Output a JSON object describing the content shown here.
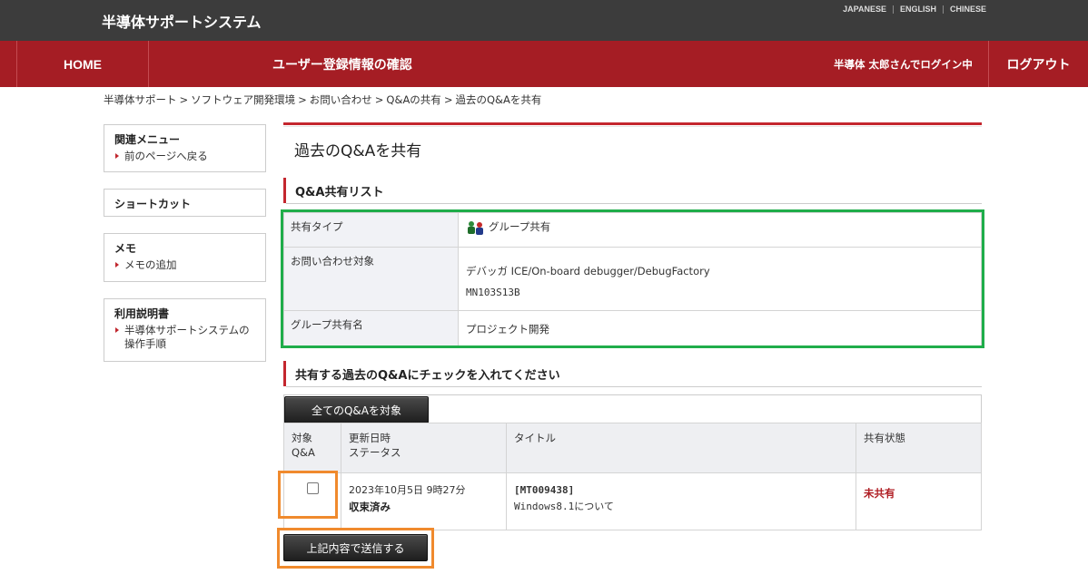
{
  "header": {
    "brand": "半導体サポートシステム",
    "languages": [
      "JAPANESE",
      "ENGLISH",
      "CHINESE"
    ]
  },
  "nav": {
    "home": "HOME",
    "title": "ユーザー登録情報の確認",
    "user_status": "半導体 太郎さんでログイン中",
    "logout": "ログアウト"
  },
  "breadcrumb": [
    "半導体サポート",
    "ソフトウェア開発環境",
    "お問い合わせ",
    "Q&Aの共有",
    "過去のQ&Aを共有"
  ],
  "breadcrumb_separator": ">",
  "sidebar": {
    "related_menu": {
      "title": "関連メニュー",
      "link": "前のページへ戻る"
    },
    "shortcut": {
      "title": "ショートカット"
    },
    "memo": {
      "title": "メモ",
      "link": "メモの追加"
    },
    "manual": {
      "title": "利用説明書",
      "link_line1": "半導体サポートシステムの",
      "link_line2": "操作手順"
    }
  },
  "page": {
    "title": "過去のQ&Aを共有",
    "section1_title": "Q&A共有リスト",
    "section2_title": "共有する過去のQ&Aにチェックを入れてください"
  },
  "info": {
    "share_type_label": "共有タイプ",
    "share_type_value": "グループ共有",
    "share_type_icon": "group-icon",
    "inquiry_label": "お問い合わせ対象",
    "inquiry_line1": "デバッガ ICE/On-board debugger/DebugFactory",
    "inquiry_line2": "MN103S13B",
    "group_name_label": "グループ共有名",
    "group_name_value": "プロジェクト開発"
  },
  "qa_list": {
    "select_all_button": "全てのQ&Aを対象",
    "headers": {
      "target_line1": "対象",
      "target_line2": "Q&A",
      "updated_line1": "更新日時",
      "updated_line2": "ステータス",
      "title": "タイトル",
      "share_state": "共有状態"
    },
    "rows": [
      {
        "checked": false,
        "datetime": "2023年10月5日 9時27分",
        "status": "収束済み",
        "id": "[MT009438]",
        "subject": "Windows8.1について",
        "share_state": "未共有"
      }
    ],
    "submit_button": "上記内容で送信する"
  },
  "colors": {
    "nav_red": "#a51d24",
    "header_dark": "#3c3c3c",
    "highlight_green": "#1fad4a",
    "highlight_orange": "#f08a2d"
  }
}
